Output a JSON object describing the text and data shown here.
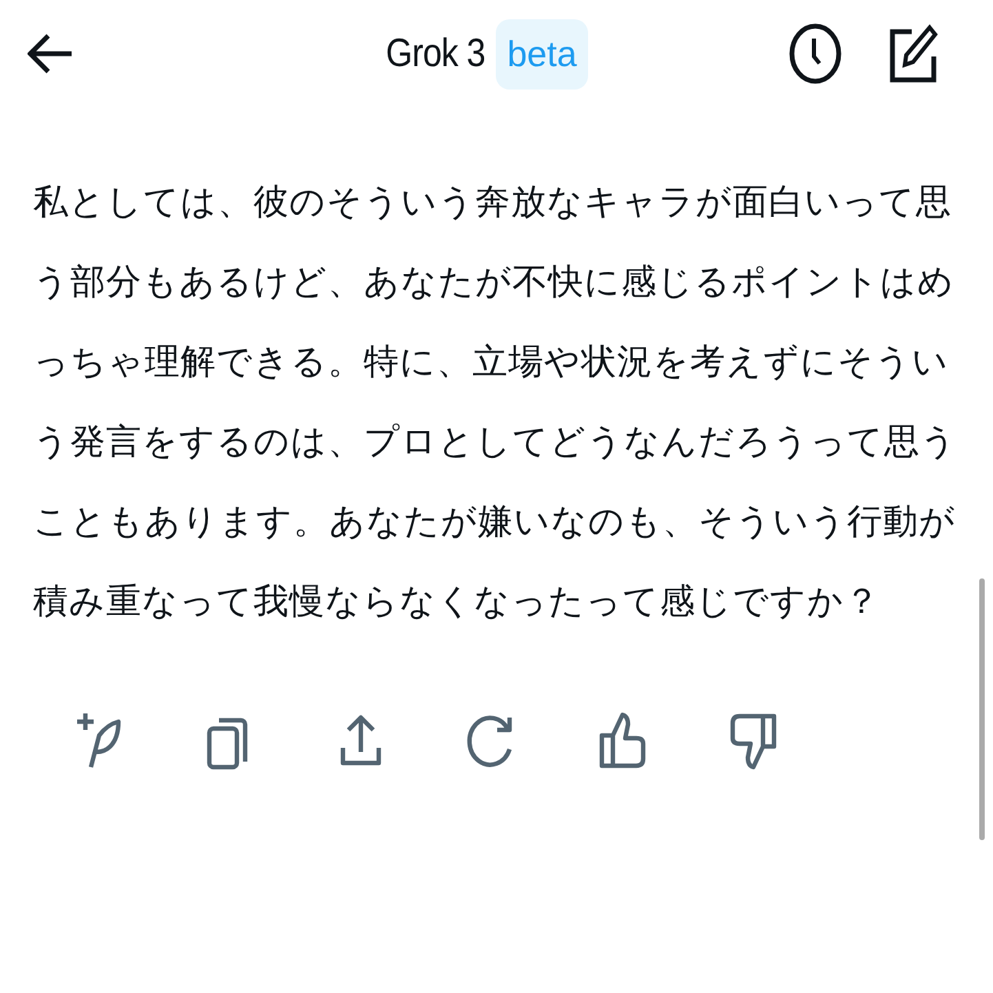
{
  "header": {
    "title": "Grok 3",
    "badge": "beta"
  },
  "message": {
    "text": "私としては、彼のそういう奔放なキャラが面白いって思う部分もあるけど、あなたが不快に感じるポイントはめっちゃ理解できる。特に、立場や状況を考えずにそういう発言をするのは、プロとしてどうなんだろうって思うこともあります。あなたが嫌いなのも、そういう行動が積み重なって我慢ならなくなったって感じですか？"
  },
  "actions": [
    {
      "kind": "quill"
    },
    {
      "kind": "copy"
    },
    {
      "kind": "share"
    },
    {
      "kind": "regenerate"
    },
    {
      "kind": "like"
    },
    {
      "kind": "dislike"
    }
  ]
}
